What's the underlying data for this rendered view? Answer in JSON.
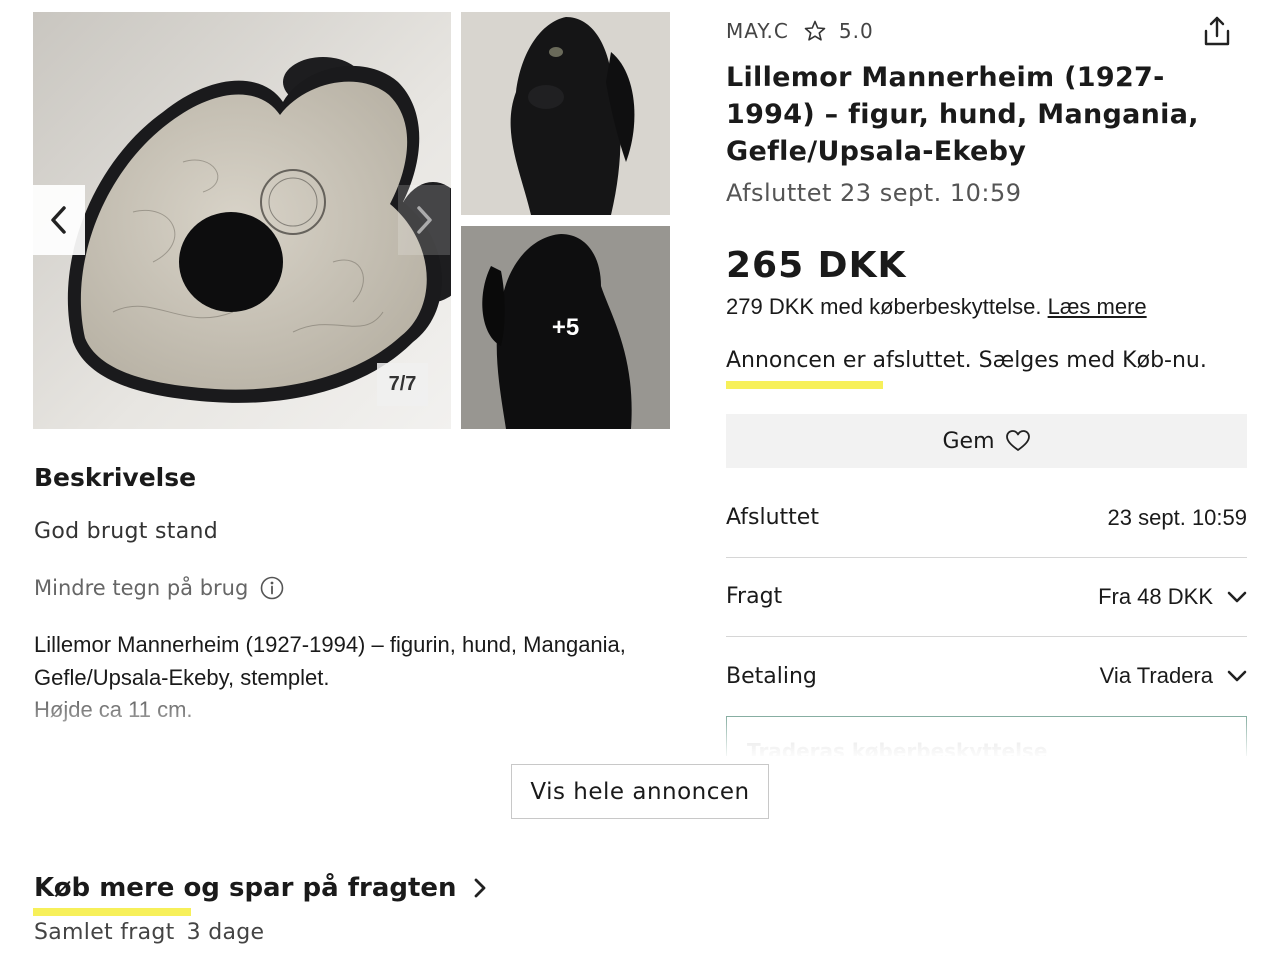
{
  "gallery": {
    "counter": "7/7",
    "more_count": "+5"
  },
  "seller": {
    "name": "MAY.C",
    "rating": "5.0"
  },
  "item": {
    "title": "Lillemor Mannerheim (1927-1994) – figur, hund, Mangania, Gefle/Upsala-Ekeby",
    "ended_subtitle": "Afsluttet 23 sept. 10:59",
    "price": "265 DKK",
    "protection_price": "279 DKK med køberbeskyttelse.",
    "read_more_link": "Læs mere",
    "status": "Annoncen er afsluttet. Sælges med Køb-nu.",
    "save_label": "Gem"
  },
  "details": {
    "ended_label": "Afsluttet",
    "ended_value": "23 sept. 10:59",
    "shipping_label": "Fragt",
    "shipping_value": "Fra 48 DKK",
    "payment_label": "Betaling",
    "payment_value": "Via Tradera",
    "protection_box_title": "Traderas køberbeskyttelse"
  },
  "description": {
    "heading": "Beskrivelse",
    "condition": "God brugt stand",
    "condition_hint": "Mindre tegn på brug",
    "body": "Lillemor Mannerheim (1927-1994) – figurin, hund, Mangania, Gefle/Upsala-Ekeby, stemplet.",
    "height": "Højde ca 11 cm."
  },
  "show_all_button": "Vis hele annoncen",
  "bundle": {
    "heading": "Køb mere og spar på fragten",
    "shipping_label": "Samlet fragt",
    "days": "3 dage"
  },
  "colors": {
    "highlight": "#f7f05a",
    "accent_border": "#5a8f7e"
  }
}
